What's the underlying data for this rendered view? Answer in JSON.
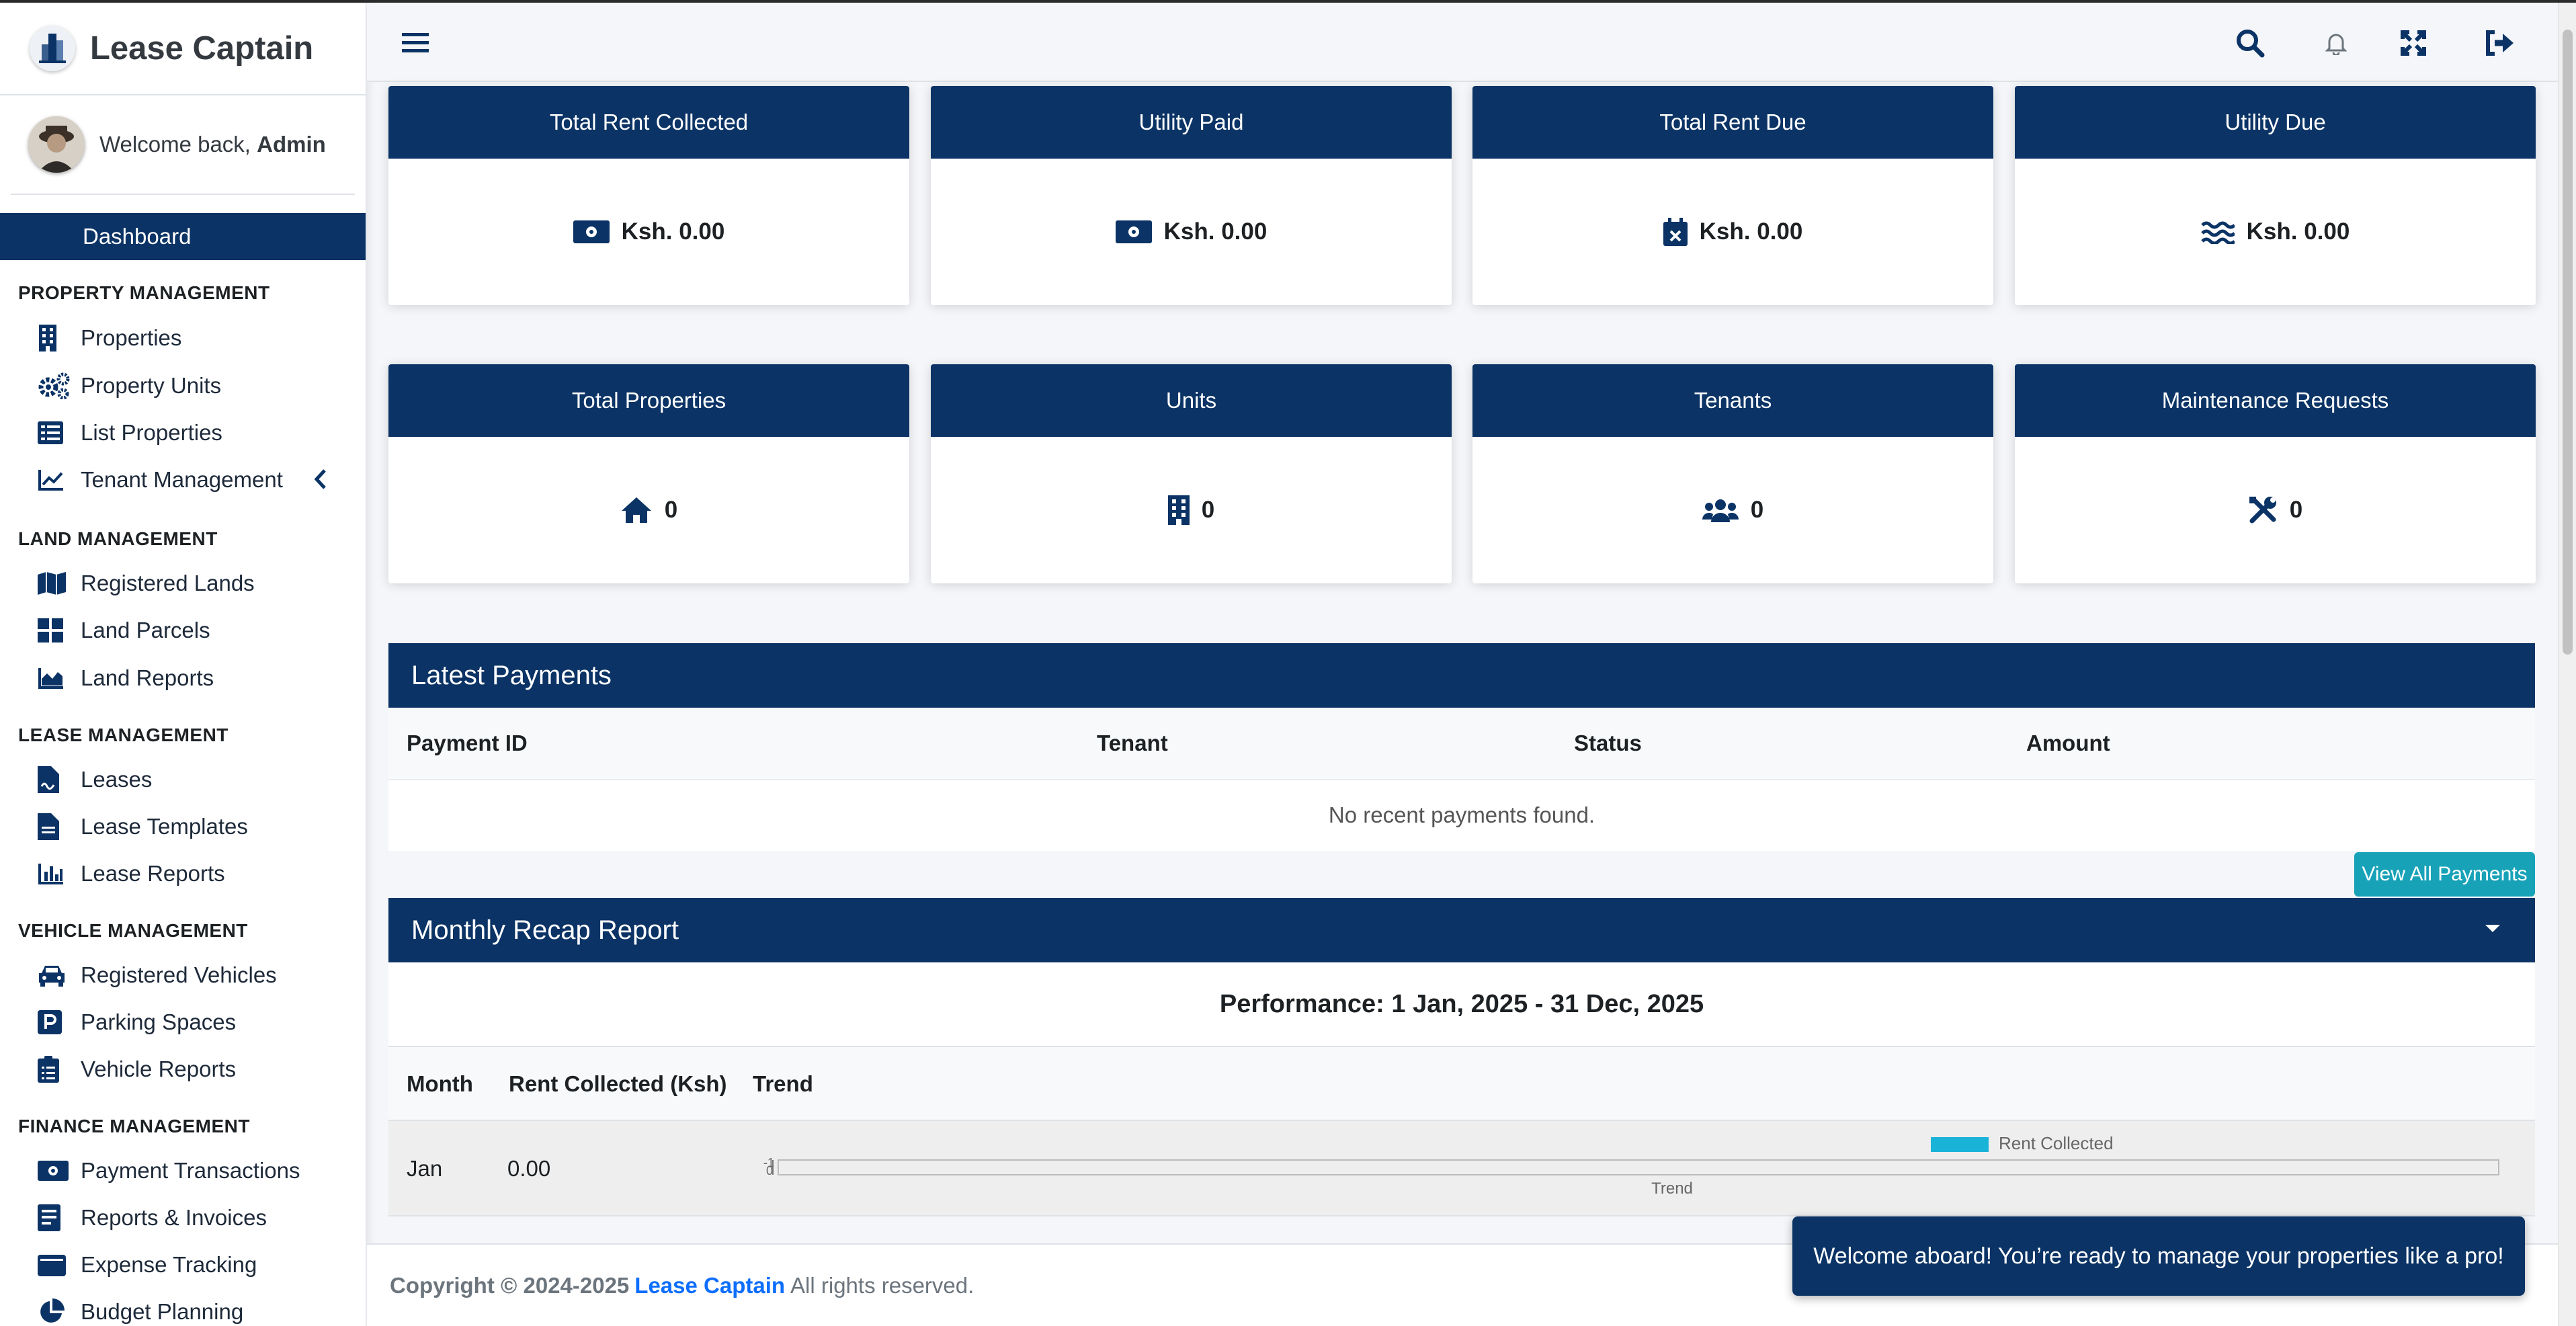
{
  "app": {
    "title": "Lease Captain",
    "accent": "#0b3365",
    "link_color": "#0d6efd",
    "button_color": "#17a2b8"
  },
  "user": {
    "welcome_prefix": "Welcome back, ",
    "name": "Admin"
  },
  "sidebar": {
    "dashboard": "Dashboard",
    "sections": [
      {
        "title": "PROPERTY MANAGEMENT",
        "items": [
          {
            "label": "Properties",
            "icon": "building-icon"
          },
          {
            "label": "Property Units",
            "icon": "gears-icon"
          },
          {
            "label": "List Properties",
            "icon": "list-icon"
          },
          {
            "label": "Tenant Management",
            "icon": "line-chart-icon"
          }
        ]
      },
      {
        "title": "LAND MANAGEMENT",
        "items": [
          {
            "label": "Registered Lands",
            "icon": "map-icon"
          },
          {
            "label": "Land Parcels",
            "icon": "grid-icon"
          },
          {
            "label": "Land Reports",
            "icon": "area-chart-icon"
          }
        ]
      },
      {
        "title": "LEASE MANAGEMENT",
        "items": [
          {
            "label": "Leases",
            "icon": "file-signature-icon"
          },
          {
            "label": "Lease Templates",
            "icon": "file-icon"
          },
          {
            "label": "Lease Reports",
            "icon": "bar-chart-icon"
          }
        ]
      },
      {
        "title": "VEHICLE MANAGEMENT",
        "items": [
          {
            "label": "Registered Vehicles",
            "icon": "car-icon"
          },
          {
            "label": "Parking Spaces",
            "icon": "parking-icon"
          },
          {
            "label": "Vehicle Reports",
            "icon": "clipboard-icon"
          }
        ]
      },
      {
        "title": "FINANCE MANAGEMENT",
        "items": [
          {
            "label": "Payment Transactions",
            "icon": "money-icon"
          },
          {
            "label": "Reports & Invoices",
            "icon": "invoice-icon"
          },
          {
            "label": "Expense Tracking",
            "icon": "wallet-icon"
          },
          {
            "label": "Budget Planning",
            "icon": "pie-chart-icon"
          }
        ]
      }
    ]
  },
  "stats_row1": [
    {
      "title": "Total Rent Collected",
      "value": "Ksh. 0.00",
      "icon": "money-bill-icon"
    },
    {
      "title": "Utility Paid",
      "value": "Ksh. 0.00",
      "icon": "money-bill-icon"
    },
    {
      "title": "Total Rent Due",
      "value": "Ksh. 0.00",
      "icon": "calendar-x-icon"
    },
    {
      "title": "Utility Due",
      "value": "Ksh. 0.00",
      "icon": "water-icon"
    }
  ],
  "stats_row2": [
    {
      "title": "Total Properties",
      "value": "0",
      "icon": "home-icon"
    },
    {
      "title": "Units",
      "value": "0",
      "icon": "building-icon"
    },
    {
      "title": "Tenants",
      "value": "0",
      "icon": "users-icon"
    },
    {
      "title": "Maintenance Requests",
      "value": "0",
      "icon": "tools-icon"
    }
  ],
  "payments": {
    "title": "Latest Payments",
    "columns": [
      "Payment ID",
      "Tenant",
      "Status",
      "Amount"
    ],
    "empty_text": "No recent payments found.",
    "view_all": "View All Payments"
  },
  "recap": {
    "title": "Monthly Recap Report",
    "performance": "Performance: 1 Jan, 2025 - 31 Dec, 2025",
    "columns": [
      "Month",
      "Rent Collected (Ksh)",
      "Trend"
    ],
    "rows": [
      {
        "month": "Jan",
        "rent": "0.00"
      }
    ]
  },
  "chart_data": {
    "type": "bar",
    "categories": [
      "Jan"
    ],
    "series": [
      {
        "name": "Rent Collected",
        "values": [
          0
        ]
      }
    ],
    "xlabel": "Trend",
    "ylabel": "",
    "tick_labels": [
      "-1",
      "0"
    ],
    "legend": "top-center",
    "colors": [
      "#1ab3d8"
    ]
  },
  "footer": {
    "prefix": "Copyright © 2024-2025 ",
    "brand": "Lease Captain",
    "suffix": " All rights reserved."
  },
  "toast": {
    "message": "Welcome aboard! You’re ready to manage your properties like a pro!"
  }
}
